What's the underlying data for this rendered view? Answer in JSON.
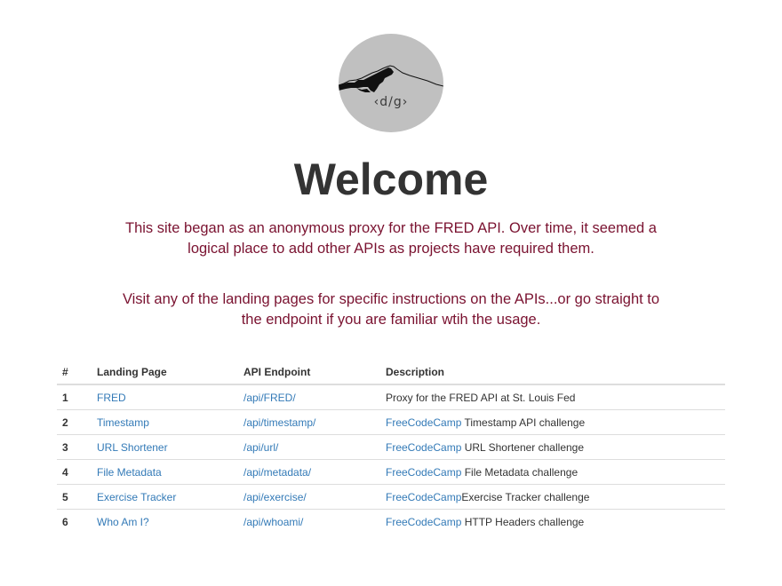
{
  "logo": {
    "text": "‹d/g›",
    "colors": {
      "background": "#c0c0c0",
      "mountain": "#000000"
    }
  },
  "title": "Welcome",
  "intro": {
    "paragraph1": "This site began as an anonymous proxy for the FRED API. Over time, it seemed a logical place to add other APIs as projects have required them.",
    "paragraph2": "Visit any of the landing pages for specific instructions on the APIs...or go straight to the endpoint if you are familiar wtih the usage."
  },
  "table": {
    "headers": {
      "num": "#",
      "landing": "Landing Page",
      "endpoint": "API Endpoint",
      "description": "Description"
    },
    "rows": [
      {
        "num": "1",
        "landing": "FRED",
        "endpoint": "/api/FRED/",
        "desc_link": "",
        "desc_text": "Proxy for the FRED API at St. Louis Fed"
      },
      {
        "num": "2",
        "landing": "Timestamp",
        "endpoint": "/api/timestamp/",
        "desc_link": "FreeCodeCamp",
        "desc_text": " Timestamp API challenge"
      },
      {
        "num": "3",
        "landing": "URL Shortener",
        "endpoint": "/api/url/",
        "desc_link": "FreeCodeCamp",
        "desc_text": " URL Shortener challenge"
      },
      {
        "num": "4",
        "landing": "File Metadata",
        "endpoint": "/api/metadata/",
        "desc_link": "FreeCodeCamp",
        "desc_text": " File Metadata challenge"
      },
      {
        "num": "5",
        "landing": "Exercise Tracker",
        "endpoint": "/api/exercise/",
        "desc_link": "FreeCodeCamp",
        "desc_text": "Exercise Tracker challenge"
      },
      {
        "num": "6",
        "landing": "Who Am I?",
        "endpoint": "/api/whoami/",
        "desc_link": "FreeCodeCamp",
        "desc_text": " HTTP Headers challenge"
      }
    ]
  },
  "colors": {
    "link": "#337ab7",
    "intro_text": "#7a1230",
    "title_text": "#333333"
  }
}
